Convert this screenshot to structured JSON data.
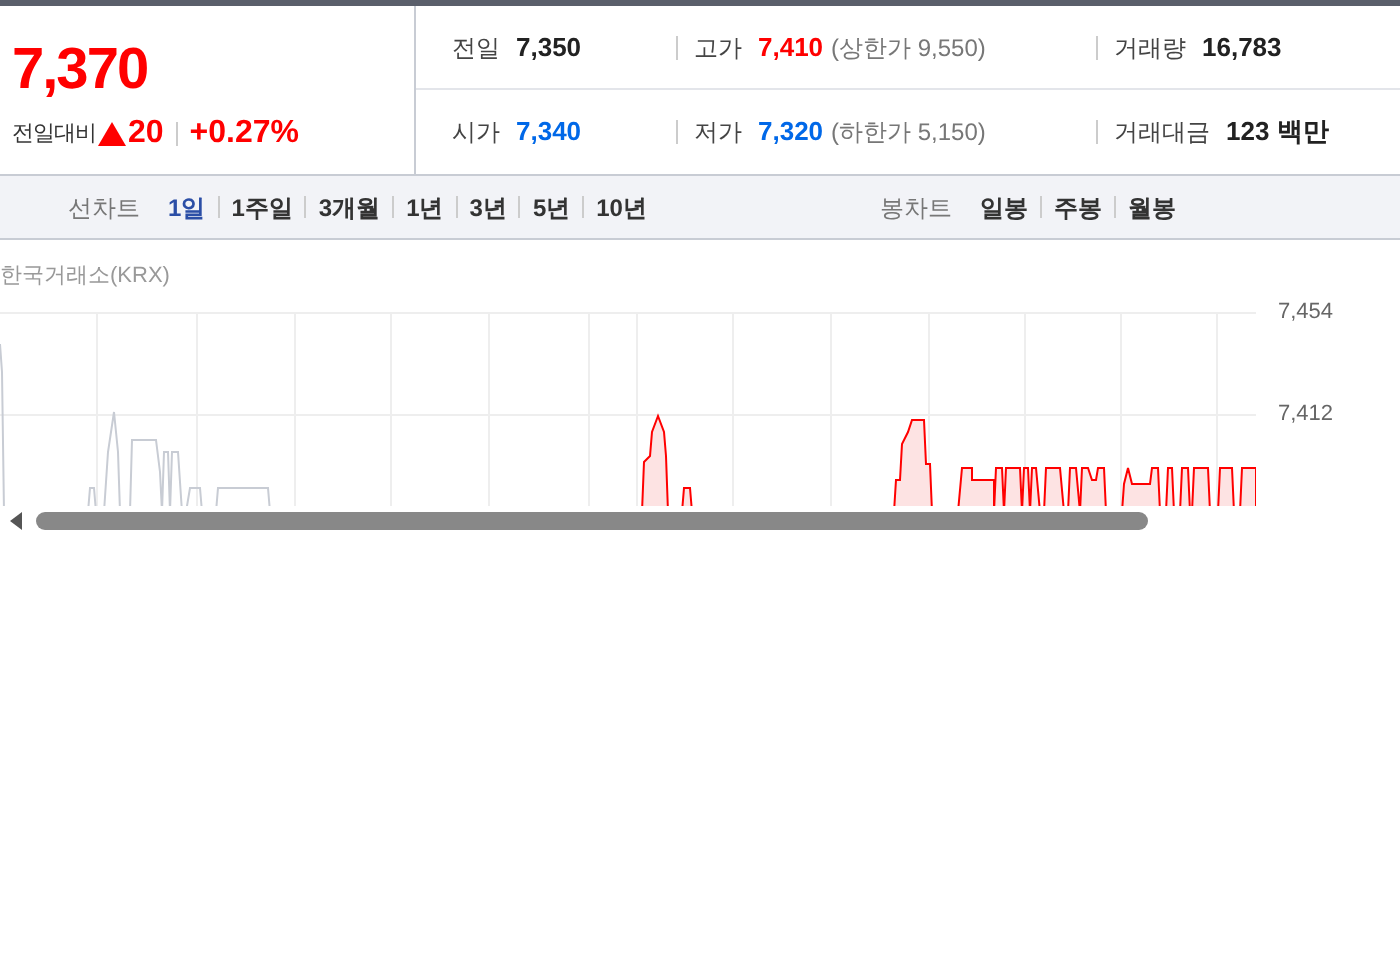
{
  "quote": {
    "price": "7,370",
    "change_label": "전일대비",
    "change": "20",
    "rising": true,
    "change_rate": "+0.27%"
  },
  "stats": [
    {
      "label": "전일",
      "value": "7,350",
      "color": "#222222"
    },
    {
      "label": "고가",
      "value": "7,410",
      "color": "#ff0000",
      "limit": "(상한가 9,550)"
    },
    {
      "label": "거래량",
      "value": "16,783",
      "color": "#222222"
    },
    {
      "label": "시가",
      "value": "7,340",
      "color": "#0068e8"
    },
    {
      "label": "저가",
      "value": "7,320",
      "color": "#0068e8",
      "limit": "(하한가 5,150)"
    },
    {
      "label": "거래대금",
      "value": "123 백만",
      "color": "#222222"
    }
  ],
  "line_chart_tabs": {
    "label": "선차트",
    "items": [
      {
        "label": "1일",
        "selected": true
      },
      {
        "label": "1주일",
        "selected": false
      },
      {
        "label": "3개월",
        "selected": false
      },
      {
        "label": "1년",
        "selected": false
      },
      {
        "label": "3년",
        "selected": false
      },
      {
        "label": "5년",
        "selected": false
      },
      {
        "label": "10년",
        "selected": false
      }
    ]
  },
  "candle_chart_tabs": {
    "label": "봉차트",
    "items": [
      {
        "label": "일봉",
        "selected": false
      },
      {
        "label": "주봉",
        "selected": false
      },
      {
        "label": "월봉",
        "selected": false
      }
    ]
  },
  "chart": {
    "source": "한국거래소(KRX)",
    "y_labels": [
      "7,454",
      "7,412"
    ]
  }
}
